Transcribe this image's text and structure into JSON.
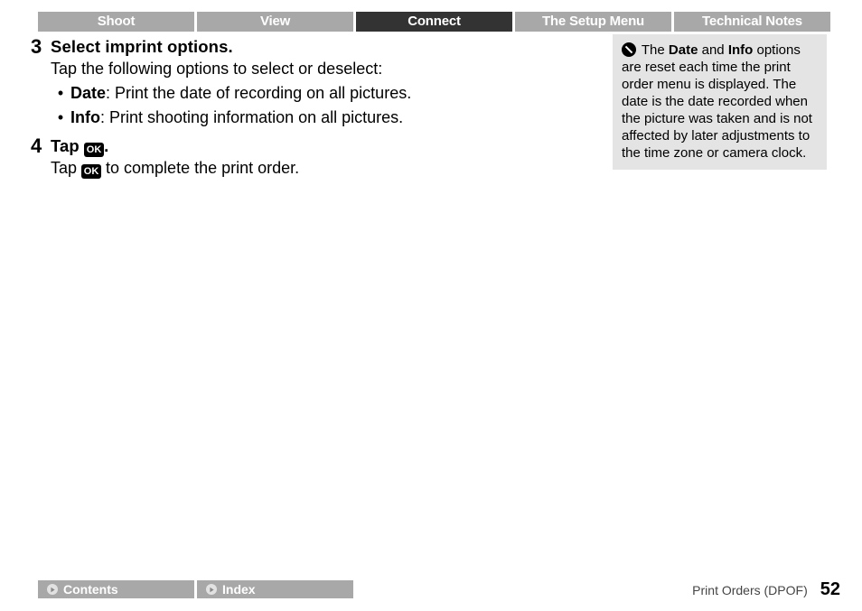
{
  "tabs": {
    "shoot": "Shoot",
    "view": "View",
    "connect": "Connect",
    "setup": "The Setup Menu",
    "tech": "Technical Notes"
  },
  "step3": {
    "num": "3",
    "title": "Select imprint options.",
    "intro": "Tap the following options to select or deselect:",
    "item1_label": "Date",
    "item1_rest": ": Print the date of recording on all pictures.",
    "item2_label": "Info",
    "item2_rest": ": Print shooting information on all pictures."
  },
  "step4": {
    "num": "4",
    "title_prefix": "Tap ",
    "title_suffix": ".",
    "body_prefix": "Tap ",
    "body_suffix": " to complete the print order."
  },
  "ok_label": "OK",
  "note": {
    "pre": " The ",
    "b1": "Date",
    "mid": " and ",
    "b2": "Info",
    "rest": " options are reset each time the print order menu is displayed. The date is the date recorded when the picture was taken and is not affected by later adjustments to the time zone or camera clock."
  },
  "footer": {
    "contents": "Contents",
    "index": "Index",
    "section": "Print Orders (DPOF)",
    "page": "52"
  }
}
